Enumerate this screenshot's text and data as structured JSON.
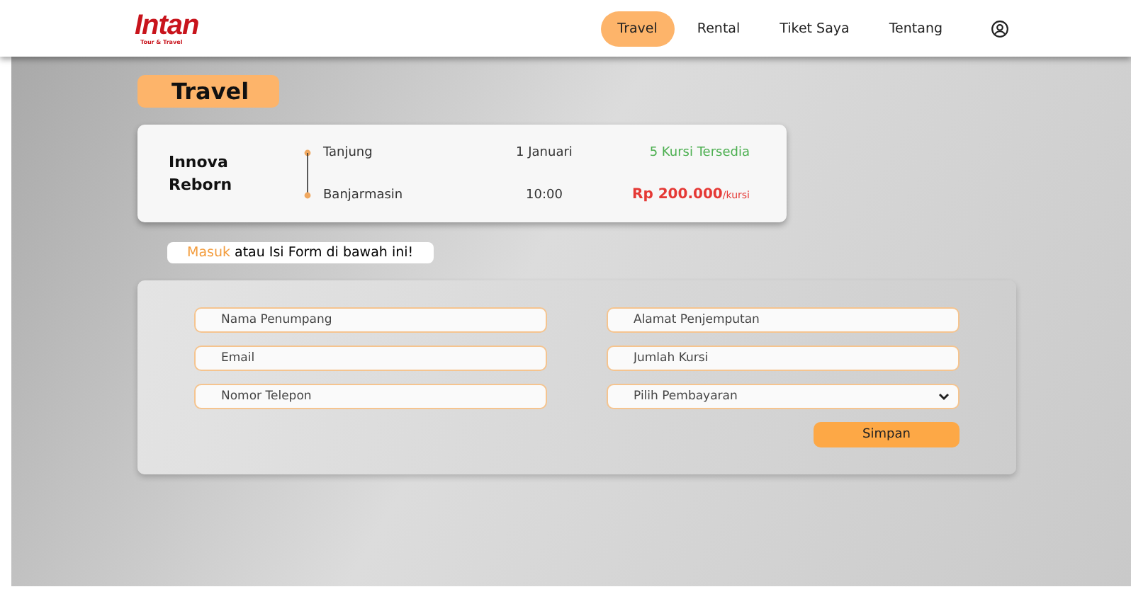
{
  "logo": {
    "name": "Intan",
    "tagline": "Tour & Travel"
  },
  "nav": [
    {
      "label": "Travel",
      "selected": true
    },
    {
      "label": "Rental",
      "selected": false
    },
    {
      "label": "Tiket Saya",
      "selected": false
    },
    {
      "label": "Tentang",
      "selected": false
    }
  ],
  "page_title": "Travel",
  "trip": {
    "vehicle": [
      "Innova",
      "Reborn"
    ],
    "from": "Tanjung",
    "to": "Banjarmasin",
    "date": "1 Januari",
    "time": "10:00",
    "seats": "5 Kursi Tersedia",
    "price": "Rp 200.000",
    "price_unit": "/kursi"
  },
  "notice": {
    "link": "Masuk",
    "text": "atau Isi Form di bawah ini!"
  },
  "form": {
    "fields": [
      {
        "kind": "input",
        "placeholder": "Nama Penumpang"
      },
      {
        "kind": "input",
        "placeholder": "Alamat Penjemputan"
      },
      {
        "kind": "input",
        "placeholder": "Email"
      },
      {
        "kind": "input",
        "placeholder": "Jumlah Kursi"
      },
      {
        "kind": "input",
        "placeholder": "Nomor Telepon"
      },
      {
        "kind": "select",
        "placeholder": "Pilih Pembayaran"
      }
    ],
    "submit": "Simpan"
  }
}
